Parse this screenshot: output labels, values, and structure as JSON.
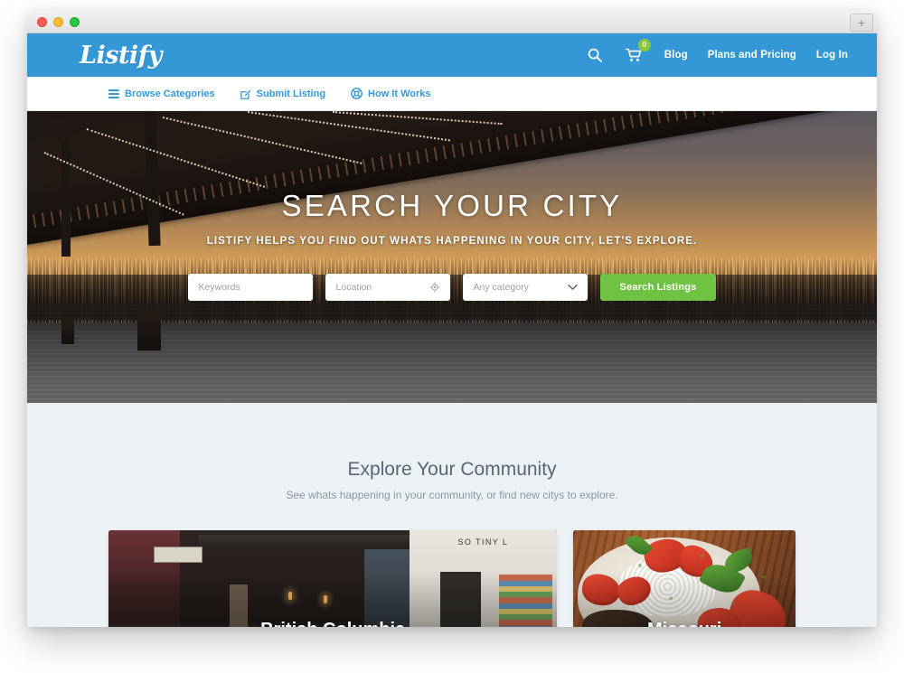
{
  "browser": {
    "traffic_lights": [
      "close",
      "minimize",
      "zoom"
    ],
    "new_tab_label": "+"
  },
  "header": {
    "logo": "Listify",
    "search_icon": "search-icon",
    "cart_icon": "shopping-cart-icon",
    "cart_count": "0",
    "links": [
      {
        "label": "Blog"
      },
      {
        "label": "Plans and Pricing"
      },
      {
        "label": "Log In"
      }
    ]
  },
  "sub_nav": {
    "items": [
      {
        "label": "Browse Categories",
        "icon": "hamburger-menu-icon"
      },
      {
        "label": "Submit Listing",
        "icon": "pencil-square-icon"
      },
      {
        "label": "How It Works",
        "icon": "lifebuoy-icon"
      }
    ]
  },
  "hero": {
    "title": "SEARCH YOUR CITY",
    "subtitle": "LISTIFY HELPS YOU FIND OUT WHATS HAPPENING IN YOUR CITY, LET'S EXPLORE.",
    "search": {
      "keywords_placeholder": "Keywords",
      "keywords_value": "",
      "location_placeholder": "Location",
      "location_value": "",
      "location_icon": "geolocate-crosshair-icon",
      "category_selected": "Any category",
      "category_icon": "chevron-down-icon",
      "submit_label": "Search Listings"
    }
  },
  "explore": {
    "title": "Explore Your Community",
    "subtitle": "See whats happening in your community, or find new citys to explore.",
    "cities": [
      {
        "name": "British Columbia",
        "art": "storefront"
      },
      {
        "name": "Missouri",
        "art": "food-plate"
      }
    ]
  },
  "theme": {
    "brand_blue": "#3498d6",
    "link_blue": "#3498db",
    "accent_green": "#70c242",
    "badge_green": "#8cc63e",
    "section_bg": "#ebf1f4",
    "heading_gray": "#5b6576",
    "muted_gray": "#8f98a6"
  }
}
